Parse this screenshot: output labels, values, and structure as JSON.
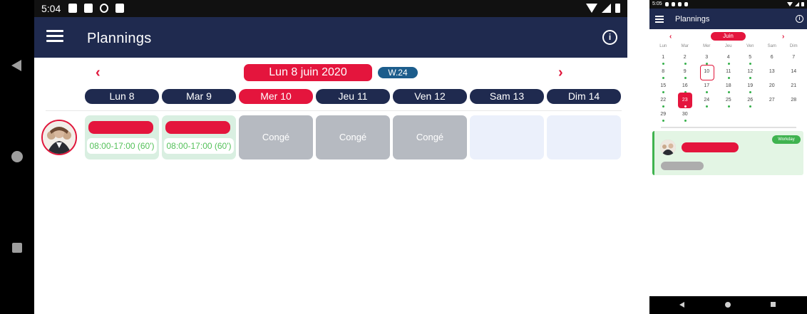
{
  "left": {
    "status": {
      "time": "5:04"
    },
    "appbar": {
      "title": "Plannings"
    },
    "nav": {
      "current_date": "Lun 8 juin 2020",
      "week": "W.24"
    },
    "days": [
      {
        "label": "Lun 8",
        "active": false
      },
      {
        "label": "Mar 9",
        "active": false
      },
      {
        "label": "Mer 10",
        "active": true
      },
      {
        "label": "Jeu 11",
        "active": false
      },
      {
        "label": "Ven 12",
        "active": false
      },
      {
        "label": "Sam 13",
        "active": false
      },
      {
        "label": "Dim 14",
        "active": false
      }
    ],
    "cells": [
      {
        "type": "work",
        "hours": "08:00-17:00 (60')"
      },
      {
        "type": "work",
        "hours": "08:00-17:00 (60')"
      },
      {
        "type": "conge",
        "label": "Congé"
      },
      {
        "type": "conge",
        "label": "Congé"
      },
      {
        "type": "conge",
        "label": "Congé"
      },
      {
        "type": "empty"
      },
      {
        "type": "empty"
      }
    ]
  },
  "right": {
    "status": {
      "time": "5:05"
    },
    "appbar": {
      "title": "Plannings"
    },
    "month": "Juin",
    "weekdays": [
      "Lun",
      "Mar",
      "Mer",
      "Jeu",
      "Ven",
      "Sam",
      "Dim"
    ],
    "weeks": [
      [
        "1",
        "2",
        "3",
        "4",
        "5",
        "6",
        "7"
      ],
      [
        "8",
        "9",
        "10",
        "11",
        "12",
        "13",
        "14"
      ],
      [
        "15",
        "16",
        "17",
        "18",
        "19",
        "20",
        "21"
      ],
      [
        "22",
        "23",
        "24",
        "25",
        "26",
        "27",
        "28"
      ],
      [
        "29",
        "30",
        "",
        "",
        "",
        "",
        ""
      ]
    ],
    "dot_days": [
      "1",
      "2",
      "3",
      "4",
      "5",
      "8",
      "9",
      "11",
      "12",
      "15",
      "16",
      "17",
      "18",
      "19",
      "22",
      "23",
      "24",
      "25",
      "26",
      "29",
      "30"
    ],
    "today": "10",
    "selected": "23",
    "card": {
      "badge": "Workday"
    }
  },
  "colors": {
    "navy": "#1f2a4f",
    "red": "#e4153d",
    "week_blue": "#1c5d8c",
    "work_green_bg": "#d9efe1",
    "hours_green": "#54c15a",
    "conge_grey": "#b6bac1",
    "empty_blue": "#ebf0fb"
  },
  "icons": [
    "menu-icon",
    "info-icon",
    "chevron-left-icon",
    "chevron-right-icon",
    "back-nav-icon",
    "home-nav-icon",
    "recents-nav-icon",
    "wifi-icon",
    "signal-icon",
    "battery-icon"
  ]
}
